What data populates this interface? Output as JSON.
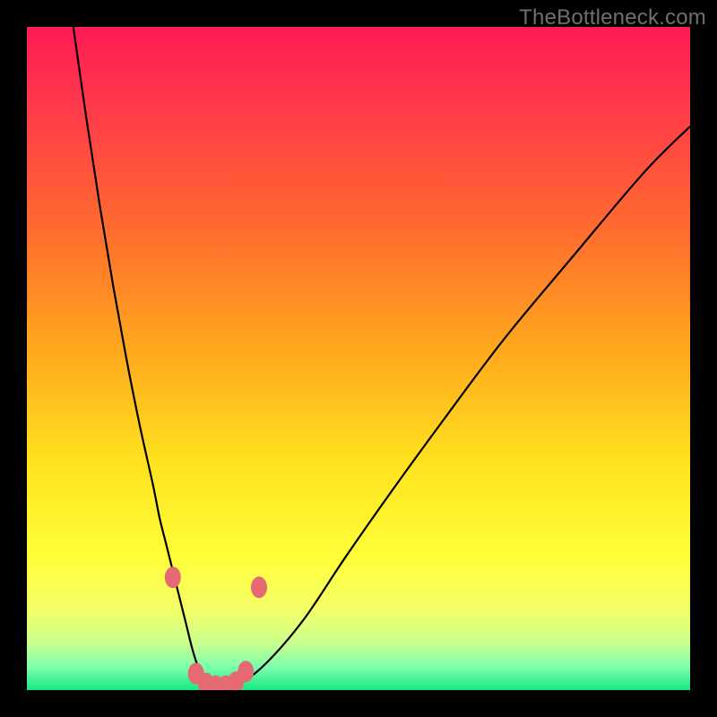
{
  "watermark": "TheBottleneck.com",
  "colors": {
    "frame": "#000000",
    "watermark": "#6f6f6f",
    "curve": "#000000",
    "marker_fill": "#e56a73",
    "marker_stroke": "#c94b57",
    "gradient_stops": [
      {
        "offset": 0.0,
        "color": "#ff1a55"
      },
      {
        "offset": 0.12,
        "color": "#ff3a4a"
      },
      {
        "offset": 0.3,
        "color": "#ff6a2f"
      },
      {
        "offset": 0.48,
        "color": "#ffa61e"
      },
      {
        "offset": 0.66,
        "color": "#ffe31e"
      },
      {
        "offset": 0.8,
        "color": "#ffff3a"
      },
      {
        "offset": 0.88,
        "color": "#f3ff69"
      },
      {
        "offset": 0.93,
        "color": "#c9ff8e"
      },
      {
        "offset": 0.965,
        "color": "#7dffad"
      },
      {
        "offset": 1.0,
        "color": "#17e884"
      }
    ]
  },
  "chart_data": {
    "type": "line",
    "title": "",
    "xlabel": "",
    "ylabel": "",
    "xlim": [
      0,
      100
    ],
    "ylim": [
      0,
      100
    ],
    "series": [
      {
        "name": "bottleneck-curve",
        "x": [
          7,
          9,
          11,
          13,
          15,
          17,
          19,
          20,
          21,
          22,
          23,
          24,
          25,
          26,
          27,
          28,
          30,
          33,
          37,
          42,
          48,
          55,
          63,
          72,
          82,
          93,
          100
        ],
        "y": [
          100,
          86,
          73,
          61,
          50,
          40,
          31,
          26,
          22,
          18,
          14,
          10,
          6,
          3,
          1.2,
          0.5,
          0.5,
          1.5,
          5,
          11,
          20,
          30,
          41,
          53,
          65,
          78,
          85
        ]
      }
    ],
    "markers": [
      {
        "x": 22.0,
        "y": 17
      },
      {
        "x": 25.5,
        "y": 2.5
      },
      {
        "x": 27.0,
        "y": 1.0
      },
      {
        "x": 28.5,
        "y": 0.6
      },
      {
        "x": 30.0,
        "y": 0.6
      },
      {
        "x": 31.5,
        "y": 1.2
      },
      {
        "x": 33.0,
        "y": 2.8
      },
      {
        "x": 35.0,
        "y": 15.5
      }
    ]
  }
}
